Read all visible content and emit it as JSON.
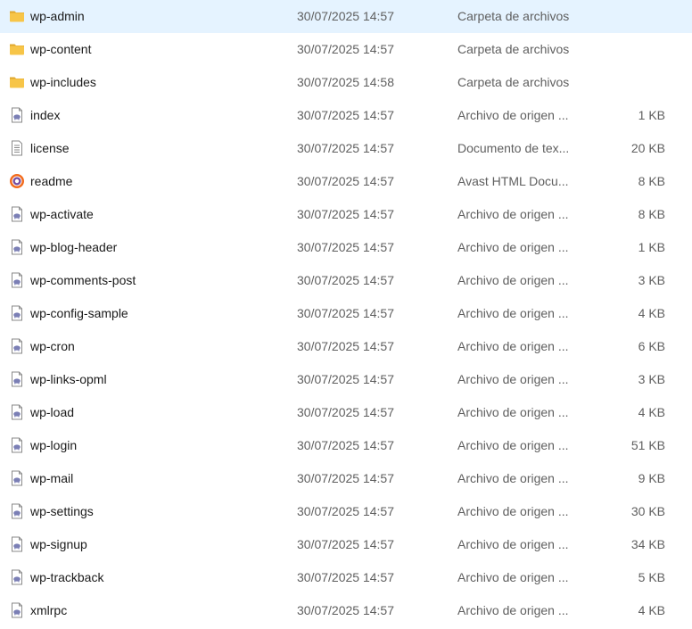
{
  "colors": {
    "folder": "#f7c548",
    "folder_dark": "#e0a82e",
    "php_elephant": "#7b7fb5",
    "avast_orange": "#f26b1d",
    "avast_purple": "#5c2d91",
    "text_primary": "#1a1a1a",
    "text_secondary": "#5f5f5f"
  },
  "files": [
    {
      "name": "wp-admin",
      "date": "30/07/2025 14:57",
      "type": "Carpeta de archivos",
      "size": "",
      "icon": "folder-icon"
    },
    {
      "name": "wp-content",
      "date": "30/07/2025 14:57",
      "type": "Carpeta de archivos",
      "size": "",
      "icon": "folder-icon"
    },
    {
      "name": "wp-includes",
      "date": "30/07/2025 14:58",
      "type": "Carpeta de archivos",
      "size": "",
      "icon": "folder-icon"
    },
    {
      "name": "index",
      "date": "30/07/2025 14:57",
      "type": "Archivo de origen ...",
      "size": "1 KB",
      "icon": "php-file-icon"
    },
    {
      "name": "license",
      "date": "30/07/2025 14:57",
      "type": "Documento de tex...",
      "size": "20 KB",
      "icon": "text-file-icon"
    },
    {
      "name": "readme",
      "date": "30/07/2025 14:57",
      "type": "Avast HTML Docu...",
      "size": "8 KB",
      "icon": "avast-html-icon"
    },
    {
      "name": "wp-activate",
      "date": "30/07/2025 14:57",
      "type": "Archivo de origen ...",
      "size": "8 KB",
      "icon": "php-file-icon"
    },
    {
      "name": "wp-blog-header",
      "date": "30/07/2025 14:57",
      "type": "Archivo de origen ...",
      "size": "1 KB",
      "icon": "php-file-icon"
    },
    {
      "name": "wp-comments-post",
      "date": "30/07/2025 14:57",
      "type": "Archivo de origen ...",
      "size": "3 KB",
      "icon": "php-file-icon"
    },
    {
      "name": "wp-config-sample",
      "date": "30/07/2025 14:57",
      "type": "Archivo de origen ...",
      "size": "4 KB",
      "icon": "php-file-icon"
    },
    {
      "name": "wp-cron",
      "date": "30/07/2025 14:57",
      "type": "Archivo de origen ...",
      "size": "6 KB",
      "icon": "php-file-icon"
    },
    {
      "name": "wp-links-opml",
      "date": "30/07/2025 14:57",
      "type": "Archivo de origen ...",
      "size": "3 KB",
      "icon": "php-file-icon"
    },
    {
      "name": "wp-load",
      "date": "30/07/2025 14:57",
      "type": "Archivo de origen ...",
      "size": "4 KB",
      "icon": "php-file-icon"
    },
    {
      "name": "wp-login",
      "date": "30/07/2025 14:57",
      "type": "Archivo de origen ...",
      "size": "51 KB",
      "icon": "php-file-icon"
    },
    {
      "name": "wp-mail",
      "date": "30/07/2025 14:57",
      "type": "Archivo de origen ...",
      "size": "9 KB",
      "icon": "php-file-icon"
    },
    {
      "name": "wp-settings",
      "date": "30/07/2025 14:57",
      "type": "Archivo de origen ...",
      "size": "30 KB",
      "icon": "php-file-icon"
    },
    {
      "name": "wp-signup",
      "date": "30/07/2025 14:57",
      "type": "Archivo de origen ...",
      "size": "34 KB",
      "icon": "php-file-icon"
    },
    {
      "name": "wp-trackback",
      "date": "30/07/2025 14:57",
      "type": "Archivo de origen ...",
      "size": "5 KB",
      "icon": "php-file-icon"
    },
    {
      "name": "xmlrpc",
      "date": "30/07/2025 14:57",
      "type": "Archivo de origen ...",
      "size": "4 KB",
      "icon": "php-file-icon"
    }
  ]
}
